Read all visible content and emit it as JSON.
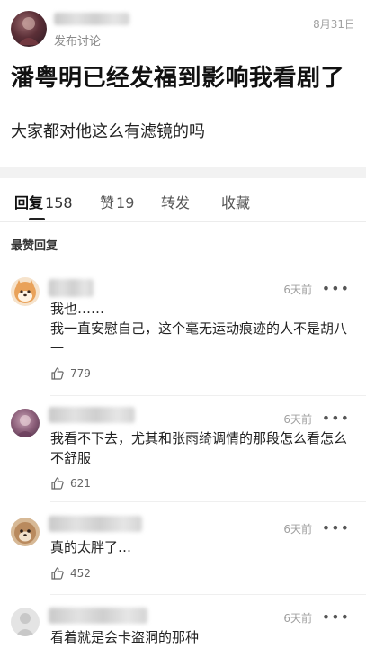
{
  "post": {
    "category": "发布讨论",
    "date": "8月31日",
    "title": "潘粤明已经发福到影响我看剧了",
    "body": "大家都对他这么有滤镜的吗"
  },
  "tabs": [
    {
      "label": "回复",
      "count": "158",
      "active": true
    },
    {
      "label": "赞",
      "count": "19",
      "active": false
    },
    {
      "label": "转发",
      "count": "",
      "active": false
    },
    {
      "label": "收藏",
      "count": "",
      "active": false
    }
  ],
  "section_label": "最赞回复",
  "comments": [
    {
      "time": "6天前",
      "more": "•••",
      "text": "我也……\n我一直安慰自己，这个毫无运动痕迹的人不是胡八一",
      "likes": "779"
    },
    {
      "time": "6天前",
      "more": "•••",
      "text": "我看不下去，尤其和张雨绮调情的那段怎么看怎么不舒服",
      "likes": "621"
    },
    {
      "time": "6天前",
      "more": "•••",
      "text": "真的太胖了…",
      "likes": "452"
    },
    {
      "time": "6天前",
      "more": "•••",
      "text": "看着就是会卡盗洞的那种",
      "likes": ""
    }
  ],
  "icons": {
    "like": "thumbs-up-icon",
    "more": "more-dots-icon"
  },
  "colors": {
    "active_tab_underline": "#222222",
    "secondary_text": "#a0a0a0"
  }
}
